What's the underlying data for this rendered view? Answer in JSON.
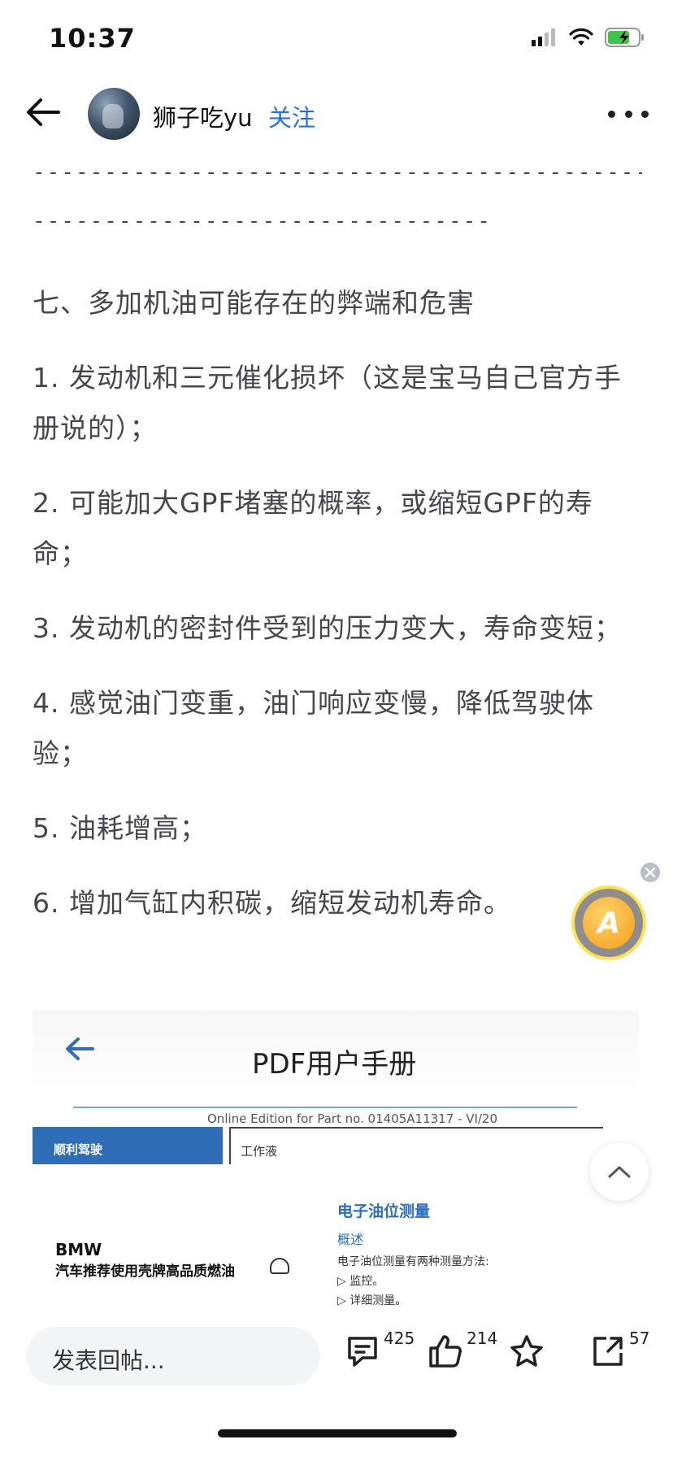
{
  "status_bar": {
    "time": "10:37"
  },
  "header": {
    "username": "狮子吃yu",
    "follow_label": "关注"
  },
  "article": {
    "divider_line_1": "------------------------------------------------",
    "divider_line_2": "--------------------------------",
    "heading": "七、多加机油可能存在的弊端和危害",
    "items": [
      "1.  发动机和三元催化损坏（这是宝马自己官方手册说的）；",
      "2. 可能加大GPF堵塞的概率，或缩短GPF的寿命；",
      "3.  发动机的密封件受到的压力变大，寿命变短；",
      "4.  感觉油门变重，油门响应变慢，降低驾驶体验；",
      "5. 油耗增高；",
      "6. 增加气缸内积碳，缩短发动机寿命。"
    ]
  },
  "pdf_image": {
    "title": "PDF用户手册",
    "online_edition": "Online Edition for Part no. 01405A11317 - VI/20",
    "tab_left": "顺利驾驶",
    "tab_right": "工作液",
    "section_title": "电子油位测量",
    "sub_title": "概述",
    "description": "电子油位测量有两种测量方法:",
    "bullet_1": "▷  监控。",
    "bullet_2": "▷  详细测量。",
    "brand": "BMW",
    "brand_line": "汽车推荐使用壳牌高品质燃油"
  },
  "floating_badge": {
    "letter": "A"
  },
  "bottom_bar": {
    "reply_placeholder": "发表回帖...",
    "comment_count": "425",
    "like_count": "214",
    "share_count": "57"
  },
  "colors": {
    "accent": "#2a6fe0",
    "body_text": "#45464f",
    "pdf_blue": "#2f6db7"
  }
}
